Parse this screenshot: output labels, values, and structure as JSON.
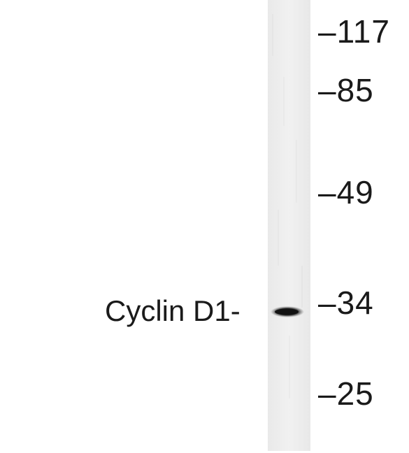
{
  "image": {
    "background": "#ffffff",
    "lane_color": "#eeeeee",
    "band_color": "#1e1e1e"
  },
  "band": {
    "label": "Cyclin D1-"
  },
  "markers": [
    {
      "label": "–117"
    },
    {
      "label": "–85"
    },
    {
      "label": "–49"
    },
    {
      "label": "–34"
    },
    {
      "label": "–25"
    }
  ]
}
